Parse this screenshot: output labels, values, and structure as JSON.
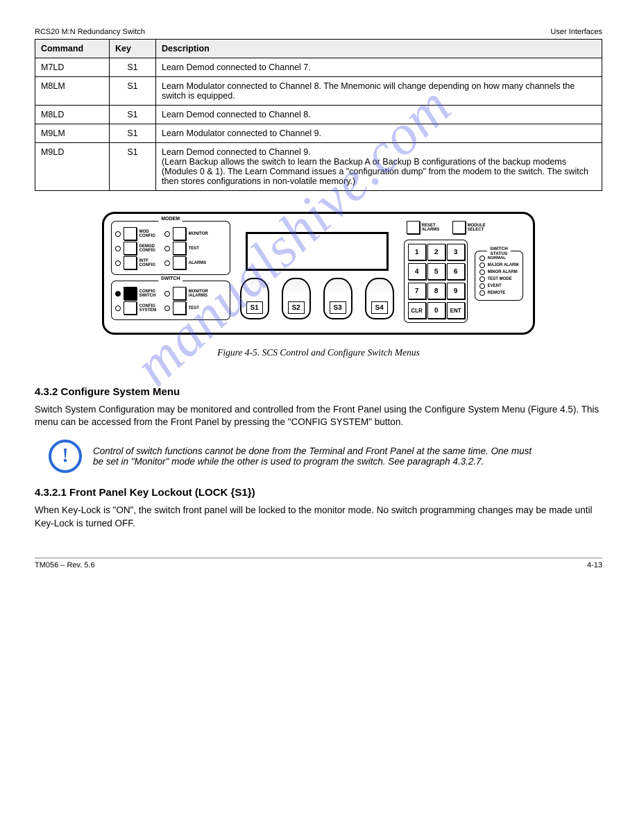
{
  "header": {
    "left": "RCS20 M:N Redundancy Switch",
    "right": "User Interfaces"
  },
  "table": {
    "headers": [
      "Command",
      "Key",
      "Description"
    ],
    "rows": [
      [
        "M7LD",
        "S1",
        "Learn Demod connected to Channel 7."
      ],
      [
        "M8LM",
        "S1",
        "Learn Modulator connected to Channel 8. The Mnemonic will change depending on how many channels the switch is equipped."
      ],
      [
        "M8LD",
        "S1",
        "Learn Demod connected to Channel 8."
      ],
      [
        "M9LM",
        "S1",
        "Learn Modulator connected to Channel 9."
      ],
      [
        "M9LD",
        "S1",
        "Learn Demod connected to Channel 9.\n(Learn Backup allows the switch to learn the Backup A or Backup B configurations of the backup modems (Modules 0 & 1). The Learn Command issues a \"configuration dump\" from the modem to the switch. The switch then stores configurations in non-volatile memory.)"
      ]
    ]
  },
  "diagram": {
    "modem": {
      "title": "MODEM",
      "rows": [
        {
          "c1": "MOD CONFIG",
          "c2": "MONITOR"
        },
        {
          "c1": "DEMOD CONFIG",
          "c2": "TEST"
        },
        {
          "c1": "INTF CONFIG",
          "c2": "ALARMS"
        }
      ]
    },
    "switch": {
      "title": "SWITCH",
      "rows": [
        {
          "c1": "CONFIG SWITCH",
          "c2": "MONITOR /ALARMS"
        },
        {
          "c1": "CONFIG SYSTEM",
          "c2": "TEST"
        }
      ]
    },
    "softkeys": [
      "S1",
      "S2",
      "S3",
      "S4"
    ],
    "topButtons": [
      {
        "name": "reset-alarms",
        "label": "RESET ALARMS"
      },
      {
        "name": "module-select",
        "label": "MODULE SELECT"
      }
    ],
    "keypad": [
      "1",
      "2",
      "3",
      "4",
      "5",
      "6",
      "7",
      "8",
      "9",
      "CLR",
      "0",
      "ENT"
    ],
    "status": {
      "title": "SWITCH STATUS",
      "items": [
        "NORMAL",
        "MAJOR ALARM",
        "MINOR ALARM",
        "TEST MODE",
        "EVENT",
        "REMOTE"
      ]
    }
  },
  "caption": "Figure 4-5. SCS Control and Configure Switch Menus",
  "sectionCfgSys": {
    "heading": "4.3.2 Configure System Menu",
    "body": "Switch System Configuration may be monitored and controlled from the Front Panel using the Configure System Menu (Figure 4.5). This menu can be accessed from the Front Panel by pressing the \"CONFIG SYSTEM\" button.",
    "note": "Control of switch functions cannot be done from the Terminal and Front Panel at the same time. One must be set in \"Monitor\" mode while the other is used to program the switch. See paragraph 4.3.2.7."
  },
  "sectionKeyLock": {
    "heading": "4.3.2.1 Front Panel Key Lockout (LOCK {S1})",
    "body": "When Key-Lock is \"ON\", the switch front panel will be locked to the monitor mode. No switch programming changes may be made until Key-Lock is turned OFF."
  },
  "footer": {
    "docnum": "TM056 – Rev. 5.6",
    "page": "4-13"
  },
  "watermark": "manualshive.com"
}
